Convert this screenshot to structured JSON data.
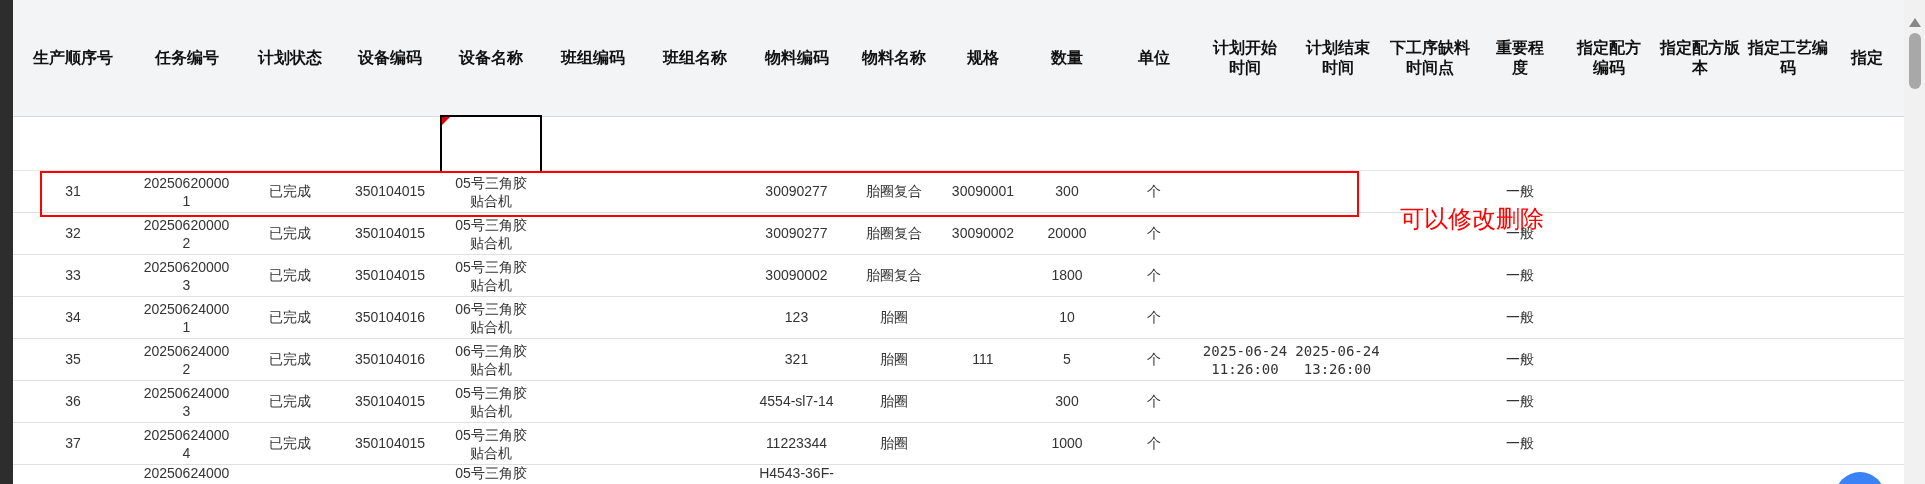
{
  "table": {
    "columns": [
      "生产顺序号",
      "任务编号",
      "计划状态",
      "设备编码",
      "设备名称",
      "班组编码",
      "班组名称",
      "物料编码",
      "物料名称",
      "规格",
      "数量",
      "单位",
      "计划开始时间",
      "计划结束时间",
      "下工序缺料时间点",
      "重要程度",
      "指定配方编码",
      "指定配方版本",
      "指定工艺编码",
      "指定"
    ],
    "filter_row": {
      "equipment_name_field": {
        "flagged": true
      }
    },
    "rows": [
      {
        "marked": true,
        "seq": "31",
        "task_no": "202506200001",
        "status": "已完成",
        "equipment_code": "350104015",
        "equipment_name": "05号三角胶贴合机",
        "material_code": "30090277",
        "material_name": "胎圈复合",
        "spec": "30090001",
        "quantity": "300",
        "unit": "个",
        "importance": "一般"
      },
      {
        "marked": false,
        "seq": "32",
        "task_no": "202506200002",
        "status": "已完成",
        "equipment_code": "350104015",
        "equipment_name": "05号三角胶贴合机",
        "material_code": "30090277",
        "material_name": "胎圈复合",
        "spec": "30090002",
        "quantity": "20000",
        "unit": "个",
        "importance": "一般"
      },
      {
        "marked": false,
        "seq": "33",
        "task_no": "202506200003",
        "status": "已完成",
        "equipment_code": "350104015",
        "equipment_name": "05号三角胶贴合机",
        "material_code": "30090002",
        "material_name": "胎圈复合",
        "quantity": "1800",
        "unit": "个",
        "importance": "一般"
      },
      {
        "marked": false,
        "seq": "34",
        "task_no": "202506240001",
        "status": "已完成",
        "equipment_code": "350104016",
        "equipment_name": "06号三角胶贴合机",
        "material_code": "123",
        "material_name": "胎圈",
        "quantity": "10",
        "unit": "个",
        "importance": "一般"
      },
      {
        "marked": false,
        "seq": "35",
        "task_no": "202506240002",
        "status": "已完成",
        "equipment_code": "350104016",
        "equipment_name": "06号三角胶贴合机",
        "material_code": "321",
        "material_name": "胎圈",
        "spec": "111",
        "quantity": "5",
        "unit": "个",
        "plan_start": "2025-06-24 11:26:00",
        "plan_end": "2025-06-24 13:26:00",
        "importance": "一般"
      },
      {
        "marked": false,
        "seq": "36",
        "task_no": "202506240003",
        "status": "已完成",
        "equipment_code": "350104015",
        "equipment_name": "05号三角胶贴合机",
        "material_code": "4554-sl7-14",
        "material_name": "胎圈",
        "quantity": "300",
        "unit": "个",
        "importance": "一般"
      },
      {
        "marked": false,
        "seq": "37",
        "task_no": "202506240004",
        "status": "已完成",
        "equipment_code": "350104015",
        "equipment_name": "05号三角胶贴合机",
        "material_code": "11223344",
        "material_name": "胎圈",
        "quantity": "1000",
        "unit": "个",
        "importance": "一般"
      },
      {
        "marked": false,
        "task_no": "20250624000",
        "equipment_name": "05号三角胶",
        "material_code": "H4543-36F-"
      }
    ]
  },
  "annotation": {
    "text": "可以修改删除"
  }
}
